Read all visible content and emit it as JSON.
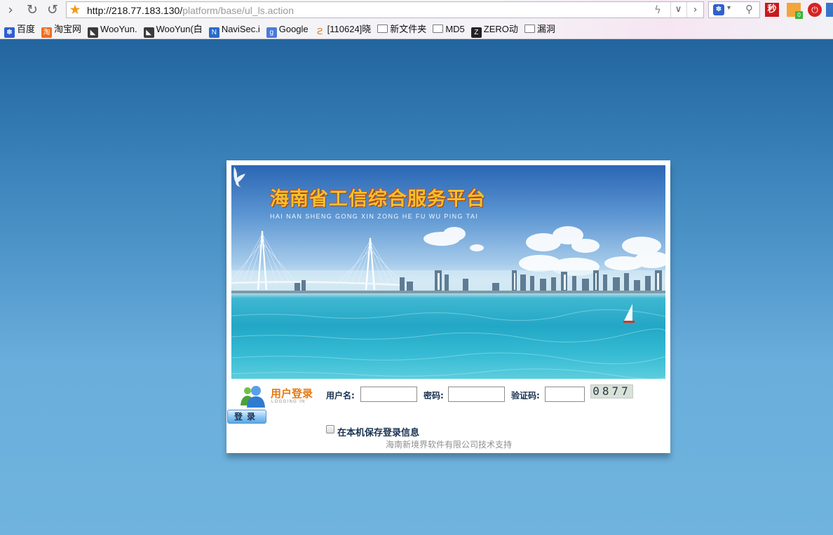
{
  "browser": {
    "url_host": "http://218.77.183.130/",
    "url_path": "platform/base/ul_ls.action",
    "ext_1_label": "秒"
  },
  "bookmarks": [
    {
      "label": "百度",
      "icon": "baidu-icon"
    },
    {
      "label": "淘宝网",
      "icon": "taobao-icon"
    },
    {
      "label": "WooYun.",
      "icon": "wooyun-icon"
    },
    {
      "label": "WooYun(白",
      "icon": "wooyun-icon"
    },
    {
      "label": "NaviSec.i",
      "icon": "navisec-icon"
    },
    {
      "label": "Google",
      "icon": "google-icon"
    },
    {
      "label": "[110624]晓",
      "icon": "weibo-icon"
    },
    {
      "label": "新文件夹",
      "icon": "folder-icon"
    },
    {
      "label": "MD5",
      "icon": "folder-icon"
    },
    {
      "label": "ZERO动",
      "icon": "zero-icon"
    },
    {
      "label": "漏洞",
      "icon": "folder-icon"
    }
  ],
  "banner": {
    "title": "海南省工信综合服务平台",
    "subtitle": "HAI NAN SHENG GONG XIN ZONG HE FU WU PING TAI"
  },
  "login": {
    "title": "用户登录",
    "title_en": "LOGGING IN",
    "username_label": "用户名:",
    "password_label": "密码:",
    "captcha_label": "验证码:",
    "captcha_text": "0877",
    "username_value": "",
    "password_value": "",
    "captcha_value": "",
    "submit_label": "登录",
    "remember_label": "在本机保存登录信息",
    "remember_checked": false,
    "footer": "海南新境界软件有限公司技术支持"
  },
  "colors": {
    "page_bg_top": "#1b5c96",
    "page_bg_bottom": "#6fb3de",
    "login_title": "#e67a12",
    "label_text": "#17314f",
    "banner_title": "#f5c02c"
  }
}
